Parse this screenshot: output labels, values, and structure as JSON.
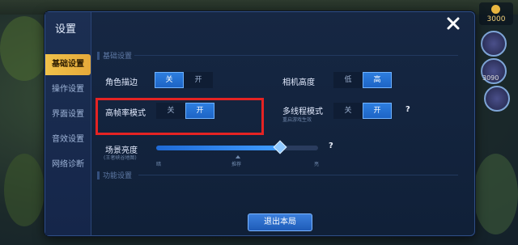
{
  "hud": {
    "gold": "3000",
    "skill_level": "3090"
  },
  "dialog": {
    "title": "设置",
    "tabs": [
      {
        "label": "基础设置",
        "active": true
      },
      {
        "label": "操作设置",
        "active": false
      },
      {
        "label": "界面设置",
        "active": false
      },
      {
        "label": "音效设置",
        "active": false
      },
      {
        "label": "网络诊断",
        "active": false
      }
    ],
    "close_icon": "close-icon"
  },
  "sections": {
    "basic": "基础设置",
    "function": "功能设置"
  },
  "settings": {
    "outline": {
      "label": "角色描边",
      "off": "关",
      "on": "开",
      "value": "关"
    },
    "camera_height": {
      "label": "相机高度",
      "low": "低",
      "high": "高",
      "value": "高"
    },
    "high_fps": {
      "label": "高帧率模式",
      "off": "关",
      "on": "开",
      "value": "开"
    },
    "multithread": {
      "label": "多线程模式",
      "sublabel": "重启游戏生效",
      "off": "关",
      "on": "开",
      "value": "开",
      "help": "?"
    },
    "brightness": {
      "label": "场景亮度",
      "sublabel": "(王者峡谷地图)",
      "help": "?",
      "min_label": "暗",
      "mid_label": "推荐",
      "max_label": "亮",
      "value": 0.76
    }
  },
  "exit_button": "退出本局",
  "colors": {
    "accent_tab": "#f0c24a",
    "toggle_on": "#2e7fe0",
    "highlight": "#e52323"
  }
}
